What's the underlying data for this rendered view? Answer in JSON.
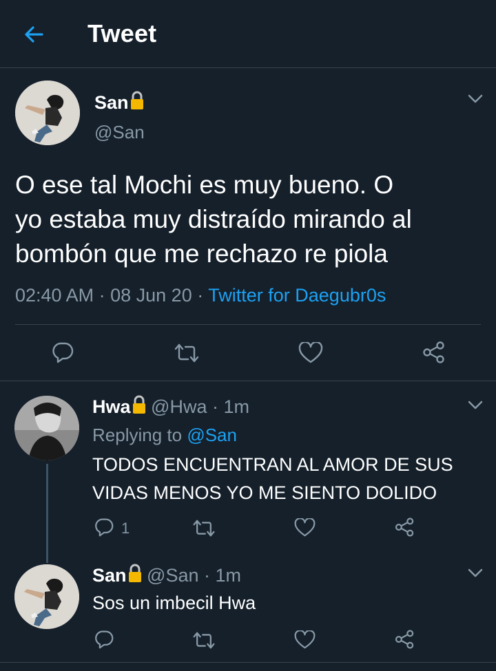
{
  "header": {
    "title": "Tweet"
  },
  "main_tweet": {
    "name": "San",
    "handle": "@San",
    "text_lines": [
      "O ese tal Mochi es muy bueno. O",
      "yo estaba muy distraído mirando al",
      "bombón que me rechazo re piola"
    ],
    "time": "02:40 AM",
    "date": "08 Jun 20",
    "separator": "·",
    "source": "Twitter for Daegubr0s"
  },
  "replies": [
    {
      "name": "Hwa",
      "handle": "@Hwa",
      "time": "1m",
      "replying_prefix": "Replying to",
      "replying_to": "@San",
      "text_lines": [
        "TODOS ENCUENTRAN AL AMOR DE SUS",
        "VIDAS MENOS YO ME SIENTO DOLIDO"
      ],
      "reply_count": "1"
    },
    {
      "name": "San",
      "handle": "@San",
      "time": "1m",
      "text_lines": [
        "Sos un imbecil Hwa"
      ]
    }
  ],
  "icons": {
    "back": "arrow-left-icon",
    "lock": "lock-icon",
    "reply": "reply-icon",
    "retweet": "retweet-icon",
    "like": "heart-icon",
    "share": "share-icon",
    "more": "chevron-down-icon"
  },
  "colors": {
    "background": "#15202b",
    "accent": "#1da1f2",
    "muted": "#8899a6",
    "divider": "#38444d",
    "lock": "#f5b800"
  }
}
